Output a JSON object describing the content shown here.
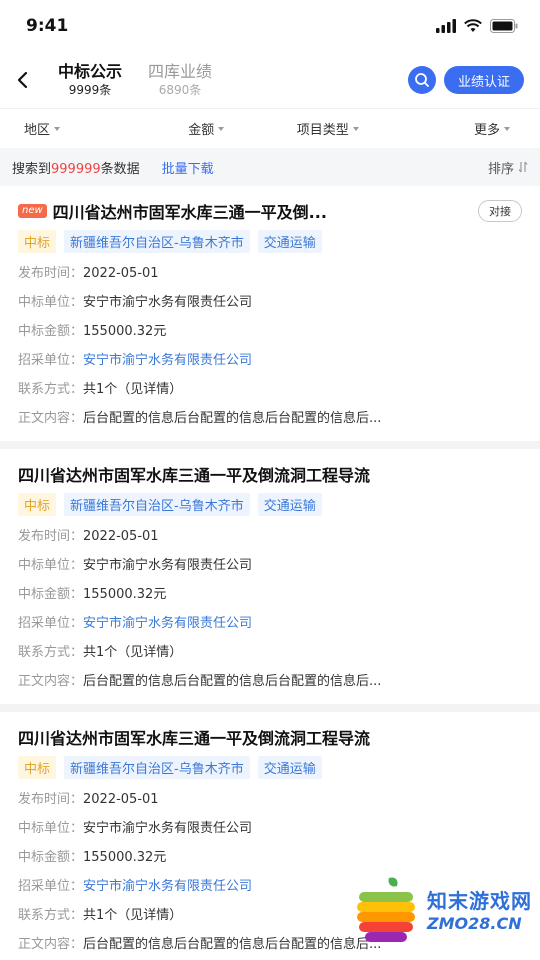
{
  "status": {
    "time": "9:41"
  },
  "nav": {
    "tabs": [
      {
        "label": "中标公示",
        "count": "9999条"
      },
      {
        "label": "四库业绩",
        "count": "6890条"
      }
    ],
    "cert_label": "业绩认证"
  },
  "filters": [
    "地区",
    "金额",
    "项目类型",
    "更多"
  ],
  "result": {
    "prefix": "搜索到",
    "count": "999999",
    "suffix": "条数据",
    "batch_label": "批量下载",
    "sort_label": "排序"
  },
  "labels": {
    "publish": "发布时间：",
    "winner": "中标单位：",
    "amount": "中标金额：",
    "buyer": "招采单位：",
    "contact": "联系方式：",
    "content": "正文内容："
  },
  "cards": [
    {
      "badge": "new",
      "title": "四川省达州市固军水库三通一平及倒...",
      "contact_btn": "对接",
      "tags": [
        "中标",
        "新疆维吾尔自治区-乌鲁木齐市",
        "交通运输"
      ],
      "publish": "2022-05-01",
      "winner": "安宁市渝宁水务有限责任公司",
      "amount": "155000.32元",
      "buyer": "安宁市渝宁水务有限责任公司",
      "contact": "共1个（见详情）",
      "content": "后台配置的信息后台配置的信息后台配置的信息后..."
    },
    {
      "title": "四川省达州市固军水库三通一平及倒流洞工程导流",
      "tags": [
        "中标",
        "新疆维吾尔自治区-乌鲁木齐市",
        "交通运输"
      ],
      "publish": "2022-05-01",
      "winner": "安宁市渝宁水务有限责任公司",
      "amount": "155000.32元",
      "buyer": "安宁市渝宁水务有限责任公司",
      "contact": "共1个（见详情）",
      "content": "后台配置的信息后台配置的信息后台配置的信息后..."
    },
    {
      "title": "四川省达州市固军水库三通一平及倒流洞工程导流",
      "tags": [
        "中标",
        "新疆维吾尔自治区-乌鲁木齐市",
        "交通运输"
      ],
      "publish": "2022-05-01",
      "winner": "安宁市渝宁水务有限责任公司",
      "amount": "155000.32元",
      "buyer": "安宁市渝宁水务有限责任公司",
      "contact": "共1个（见详情）",
      "content": "后台配置的信息后台配置的信息后台配置的信息后..."
    }
  ],
  "watermark": {
    "cn": "知末游戏网",
    "en": "ZMO28.CN"
  },
  "colors": {
    "accent": "#3a6df0",
    "highlight": "#e44444",
    "tag_win": "#e2a42a",
    "link": "#3a78d8"
  }
}
